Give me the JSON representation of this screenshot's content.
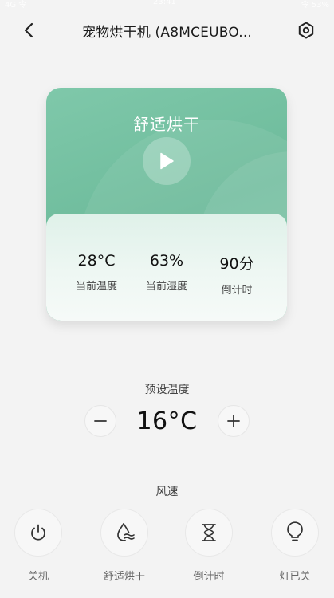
{
  "status_bar": {
    "left": "4G 令",
    "center": "23:41",
    "right": "令 53%"
  },
  "header": {
    "title": "宠物烘干机 (A8MCEUBO..."
  },
  "card": {
    "mode": "舒适烘干",
    "stats": [
      {
        "value": "28°C",
        "label": "当前温度"
      },
      {
        "value": "63%",
        "label": "当前湿度"
      },
      {
        "value": "90分",
        "label": "倒计时"
      }
    ]
  },
  "preset": {
    "label": "预设温度",
    "value": "16°C"
  },
  "wind": {
    "label": "风速"
  },
  "controls": [
    {
      "label": "关机",
      "icon": "power-icon"
    },
    {
      "label": "舒适烘干",
      "icon": "water-drop-wind-icon"
    },
    {
      "label": "倒计时",
      "icon": "hourglass-icon"
    },
    {
      "label": "灯已关",
      "icon": "lightbulb-icon"
    }
  ],
  "colors": {
    "accent": "#6dbb9b",
    "background": "#f3f3f3"
  }
}
